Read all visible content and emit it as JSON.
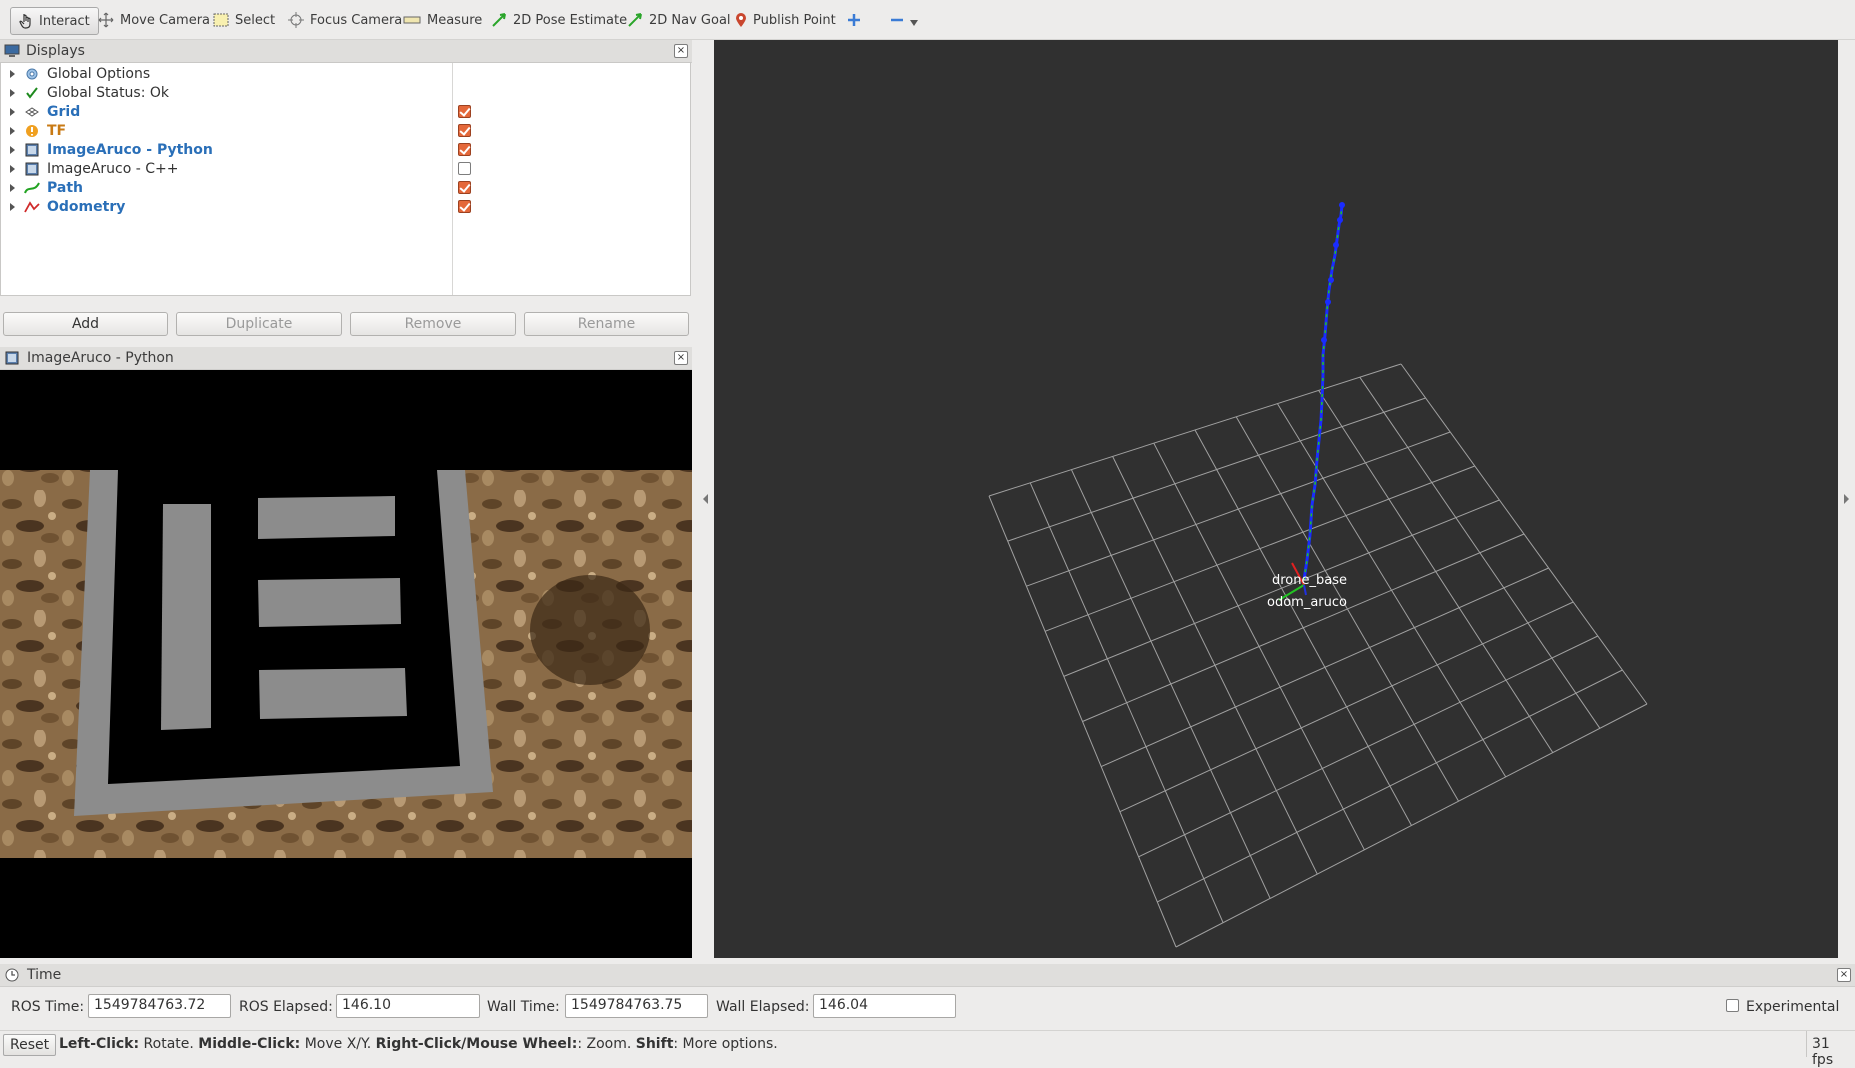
{
  "toolbar": {
    "tools": [
      {
        "label": "Interact",
        "icon": "hand-pointer-icon"
      },
      {
        "label": "Move Camera",
        "icon": "move-camera-icon"
      },
      {
        "label": "Select",
        "icon": "select-icon"
      },
      {
        "label": "Focus Camera",
        "icon": "focus-camera-icon"
      },
      {
        "label": "Measure",
        "icon": "measure-icon"
      },
      {
        "label": "2D Pose Estimate",
        "icon": "pose-estimate-icon"
      },
      {
        "label": "2D Nav Goal",
        "icon": "nav-goal-icon"
      },
      {
        "label": "Publish Point",
        "icon": "publish-point-icon"
      }
    ]
  },
  "displays_panel": {
    "title": "Displays",
    "items": [
      {
        "label": "Global Options",
        "icon": "gear-icon",
        "style": "normal",
        "checkbox": null
      },
      {
        "label": "Global Status: Ok",
        "icon": "checkmark-icon",
        "style": "normal",
        "checkbox": null
      },
      {
        "label": "Grid",
        "icon": "grid-icon",
        "style": "blue",
        "checkbox": true
      },
      {
        "label": "TF",
        "icon": "warning-icon",
        "style": "orange",
        "checkbox": true
      },
      {
        "label": "ImageAruco - Python",
        "icon": "image-icon",
        "style": "blue",
        "checkbox": true
      },
      {
        "label": "ImageAruco - C++",
        "icon": "image-icon",
        "style": "normal",
        "checkbox": false
      },
      {
        "label": "Path",
        "icon": "path-icon",
        "style": "blue",
        "checkbox": true
      },
      {
        "label": "Odometry",
        "icon": "odometry-icon",
        "style": "blue",
        "checkbox": true
      }
    ],
    "buttons": {
      "add": "Add",
      "duplicate": "Duplicate",
      "remove": "Remove",
      "rename": "Rename"
    }
  },
  "image_panel": {
    "title": "ImageAruco - Python"
  },
  "view3d": {
    "frames": [
      "drone_base",
      "odom_aruco"
    ],
    "colors": {
      "background": "#303030",
      "grid": "#a0a0a0",
      "path": "#1a2cff",
      "odometry": "#22c322"
    }
  },
  "time_panel": {
    "title": "Time",
    "ros_time_label": "ROS Time:",
    "ros_time": "1549784763.72",
    "ros_elapsed_label": "ROS Elapsed:",
    "ros_elapsed": "146.10",
    "wall_time_label": "Wall Time:",
    "wall_time": "1549784763.75",
    "wall_elapsed_label": "Wall Elapsed:",
    "wall_elapsed": "146.04",
    "experimental_label": "Experimental",
    "experimental": false
  },
  "status_bar": {
    "reset": "Reset",
    "hint_parts": [
      {
        "text": "Left-Click:",
        "bold": true
      },
      {
        "text": " Rotate. ",
        "bold": false
      },
      {
        "text": "Middle-Click:",
        "bold": true
      },
      {
        "text": " Move X/Y. ",
        "bold": false
      },
      {
        "text": "Right-Click/Mouse Wheel:",
        "bold": true
      },
      {
        "text": ": Zoom. ",
        "bold": false
      },
      {
        "text": "Shift",
        "bold": true
      },
      {
        "text": ": More options.",
        "bold": false
      }
    ],
    "fps": "31 fps"
  }
}
